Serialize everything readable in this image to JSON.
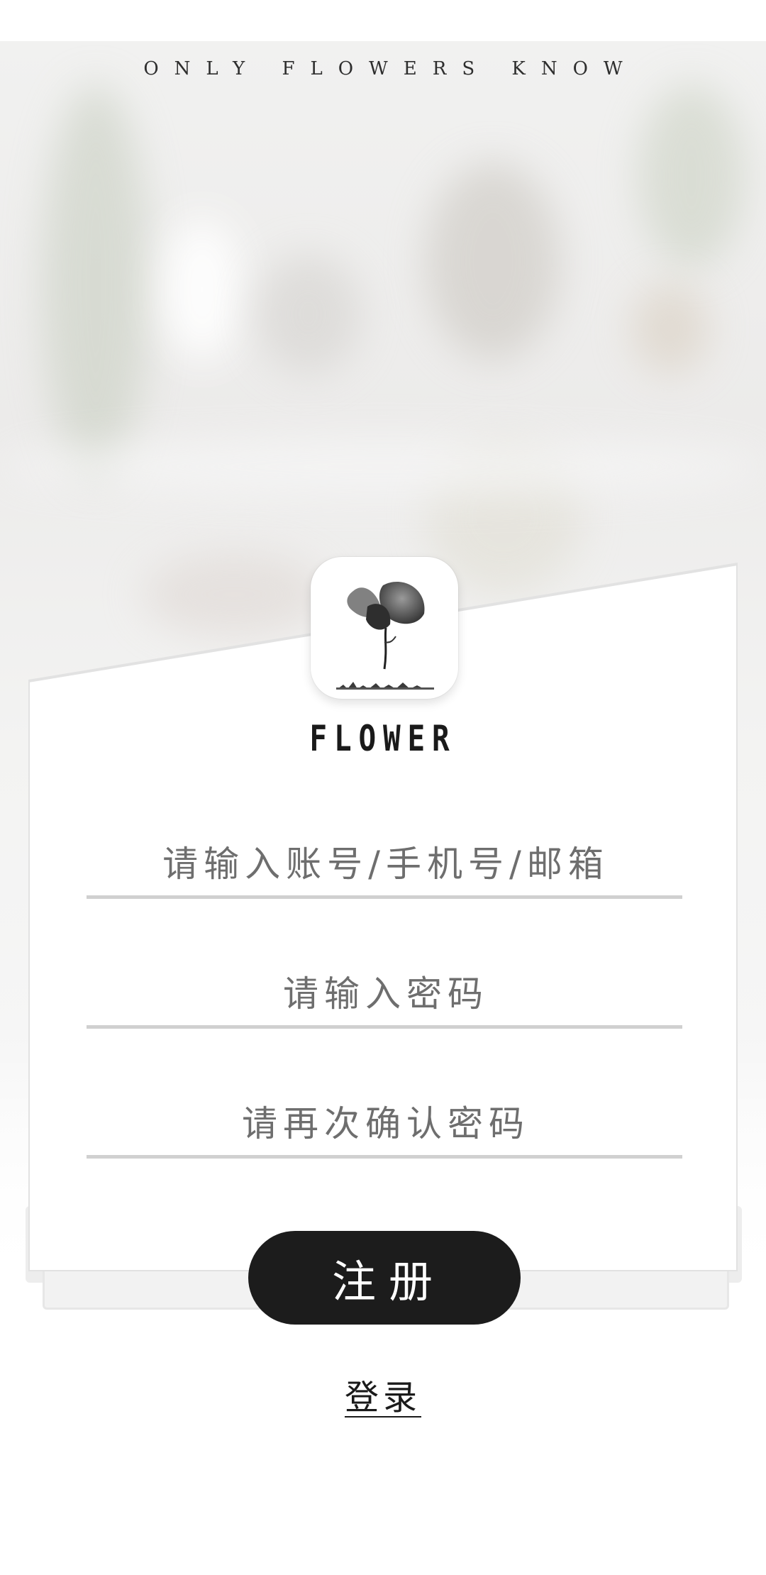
{
  "tagline": "ONLY FLOWERS KNOW",
  "brand_name": "FLOWER",
  "form": {
    "account_placeholder": "请输入账号/手机号/邮箱",
    "password_placeholder": "请输入密码",
    "confirm_password_placeholder": "请再次确认密码",
    "register_label": "注册"
  },
  "login_link_label": "登录",
  "colors": {
    "button": "#1c1c1c",
    "underline": "#d0d0d0",
    "placeholder": "#6e6e6e"
  },
  "icons": {
    "logo": "ink-flower-icon"
  }
}
